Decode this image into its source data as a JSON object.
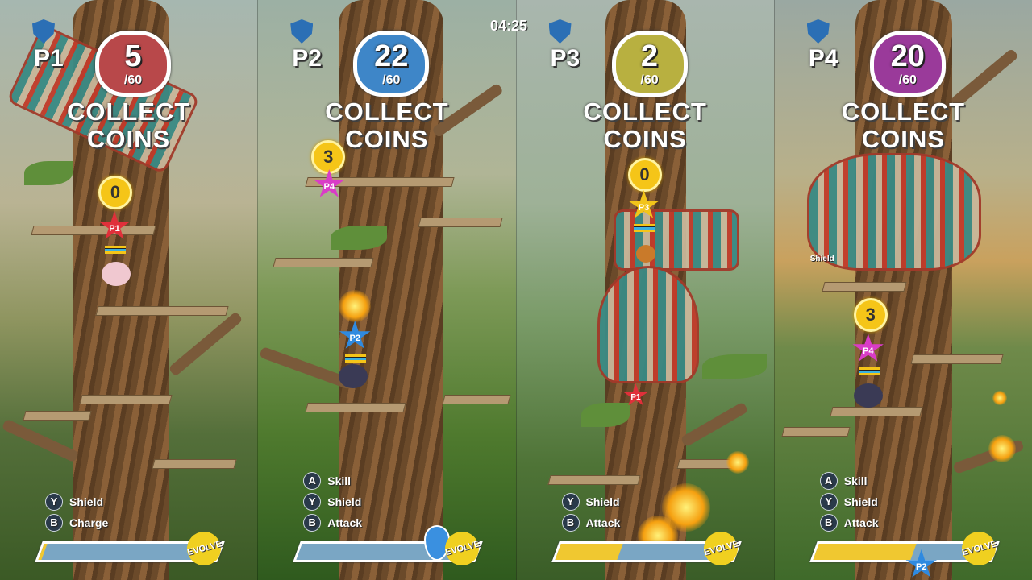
{
  "timer": "04:25",
  "objective": [
    "COLLECT",
    "COINS"
  ],
  "total_label": "/60",
  "panels": [
    {
      "player": "P1",
      "coins": "5",
      "bag_color": "#b8484a",
      "char_coins": "0",
      "char_tag": "P1",
      "star_color": "#e0303a",
      "buttons": [
        {
          "key": "Y",
          "label": "Shield"
        },
        {
          "key": "B",
          "label": "Charge"
        }
      ],
      "evolve_label": "EVOLVE",
      "evolve_progress": 0.02
    },
    {
      "player": "P2",
      "coins": "22",
      "bag_color": "#3e86c8",
      "char_coins": "3",
      "char_tag": "P2",
      "star_color": "#2f8ae0",
      "other_tag": "P4",
      "other_color": "#d93cc7",
      "buttons": [
        {
          "key": "A",
          "label": "Skill"
        },
        {
          "key": "Y",
          "label": "Shield"
        },
        {
          "key": "B",
          "label": "Attack"
        }
      ],
      "evolve_label": "EVOLVE",
      "evolve_progress": 0.0
    },
    {
      "player": "P3",
      "coins": "2",
      "bag_color": "#b8b040",
      "char_coins": "0",
      "char_tag": "P3",
      "star_color": "#f2c41a",
      "other_tag": "P1",
      "other_color": "#e0303a",
      "buttons": [
        {
          "key": "Y",
          "label": "Shield"
        },
        {
          "key": "B",
          "label": "Attack"
        }
      ],
      "evolve_label": "EVOLVE",
      "evolve_progress": 0.35
    },
    {
      "player": "P4",
      "coins": "20",
      "bag_color": "#9a3a9a",
      "char_coins": "3",
      "char_tag": "P4",
      "star_color": "#d93cc7",
      "other_tag": "P2",
      "other_color": "#2f8ae0",
      "side_text": "Shield",
      "buttons": [
        {
          "key": "A",
          "label": "Skill"
        },
        {
          "key": "Y",
          "label": "Shield"
        },
        {
          "key": "B",
          "label": "Attack"
        }
      ],
      "evolve_label": "EVOLVE",
      "evolve_progress": 0.55
    }
  ]
}
